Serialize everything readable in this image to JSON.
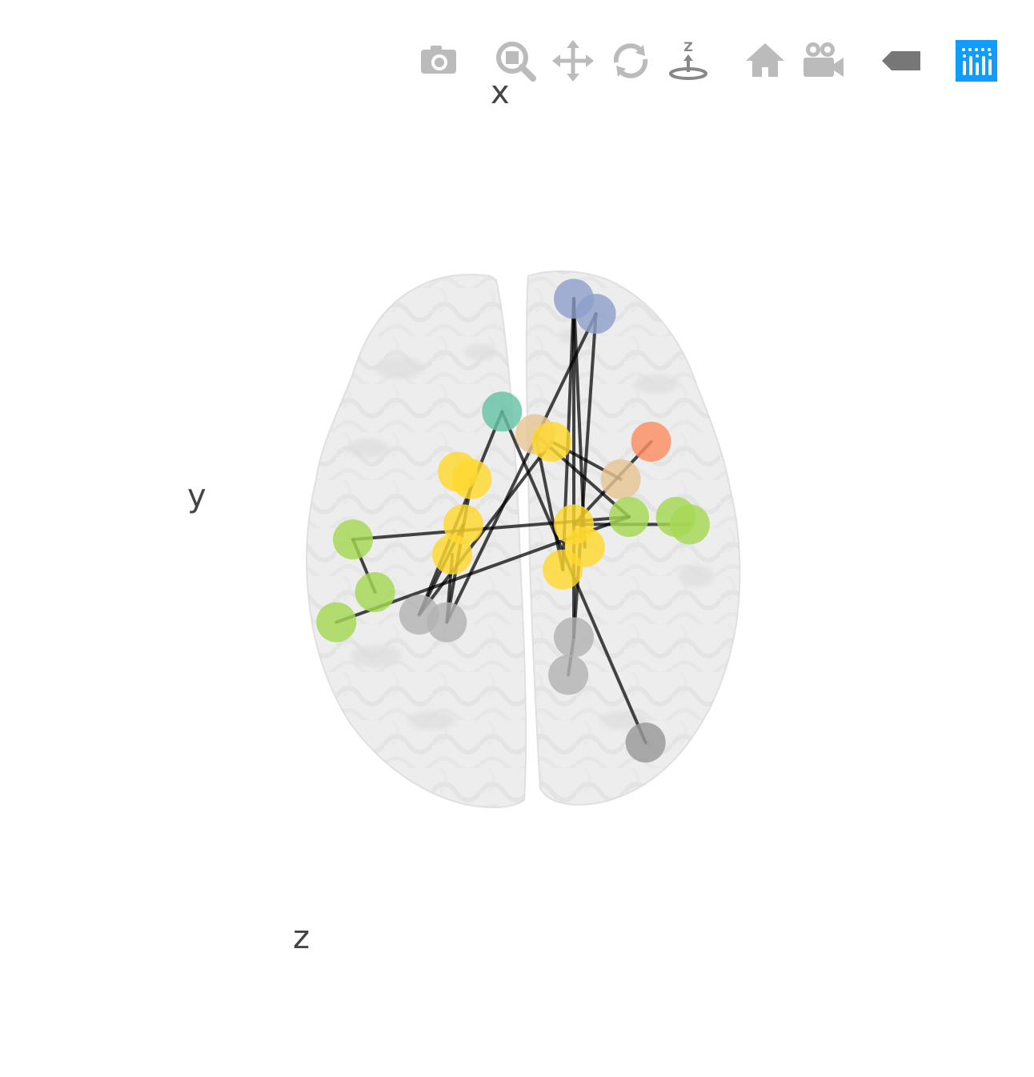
{
  "modebar": {
    "buttons": [
      {
        "name": "download-plot-button",
        "icon": "camera-icon",
        "active": false
      },
      {
        "name": "zoom-button",
        "icon": "zoom-icon",
        "active": false
      },
      {
        "name": "pan-button",
        "icon": "pan-icon",
        "active": false
      },
      {
        "name": "orbit-rotation-button",
        "icon": "orbit-rotation-icon",
        "active": false
      },
      {
        "name": "turntable-rotation-button",
        "icon": "turntable-rotation-icon",
        "active": true
      },
      {
        "name": "reset-camera-default-button",
        "icon": "home-icon",
        "active": false
      },
      {
        "name": "reset-camera-last-save-button",
        "icon": "movie-camera-icon",
        "active": false
      },
      {
        "name": "toggle-hover-button",
        "icon": "tag-icon",
        "active": false
      },
      {
        "name": "plotly-logo-link",
        "icon": "plotly-logo-icon",
        "active": false
      }
    ],
    "colors": {
      "icon": "#bbbbbb",
      "active_icon": "#888888",
      "logo_bg": "#119dff"
    }
  },
  "scene": {
    "axes": {
      "x": "x",
      "y": "y",
      "z": "z"
    },
    "colors": {
      "brain": "#e6e6e6",
      "edge": "#000000",
      "nodes": [
        "#8da0cb",
        "#66c2a5",
        "#fc8d62",
        "#e5c494",
        "#ffd92f",
        "#a6d854",
        "#b3b3b3"
      ]
    }
  },
  "chart_data": {
    "type": "scatter3d",
    "title": "",
    "note": "",
    "nodes": [
      {
        "id": 0,
        "x": 20,
        "y": 58,
        "color": "#8da0cb"
      },
      {
        "id": 1,
        "x": 28,
        "y": 54,
        "color": "#8da0cb"
      },
      {
        "id": 2,
        "x": -6,
        "y": 28,
        "color": "#66c2a5"
      },
      {
        "id": 3,
        "x": 48,
        "y": 20,
        "color": "#fc8d62"
      },
      {
        "id": 4,
        "x": 6,
        "y": 22,
        "color": "#e5c494"
      },
      {
        "id": 5,
        "x": 37,
        "y": 10,
        "color": "#e5c494"
      },
      {
        "id": 6,
        "x": 12,
        "y": 20,
        "color": "#ffd92f"
      },
      {
        "id": 7,
        "x": -22,
        "y": 12,
        "color": "#ffd92f"
      },
      {
        "id": 8,
        "x": -17,
        "y": 10,
        "color": "#ffd92f"
      },
      {
        "id": 9,
        "x": -20,
        "y": -2,
        "color": "#ffd92f"
      },
      {
        "id": 10,
        "x": -24,
        "y": -10,
        "color": "#ffd92f"
      },
      {
        "id": 11,
        "x": 20,
        "y": -2,
        "color": "#ffd92f"
      },
      {
        "id": 12,
        "x": 24,
        "y": -8,
        "color": "#ffd92f"
      },
      {
        "id": 13,
        "x": 16,
        "y": -14,
        "color": "#ffd92f"
      },
      {
        "id": 14,
        "x": -60,
        "y": -6,
        "color": "#a6d854"
      },
      {
        "id": 15,
        "x": -52,
        "y": -20,
        "color": "#a6d854"
      },
      {
        "id": 16,
        "x": -66,
        "y": -28,
        "color": "#a6d854"
      },
      {
        "id": 17,
        "x": 40,
        "y": 0,
        "color": "#a6d854"
      },
      {
        "id": 18,
        "x": 57,
        "y": 0,
        "color": "#a6d854"
      },
      {
        "id": 19,
        "x": 62,
        "y": -2,
        "color": "#a6d854"
      },
      {
        "id": 20,
        "x": -36,
        "y": -26,
        "color": "#b3b3b3"
      },
      {
        "id": 21,
        "x": -26,
        "y": -28,
        "color": "#b3b3b3"
      },
      {
        "id": 22,
        "x": 20,
        "y": -32,
        "color": "#b3b3b3"
      },
      {
        "id": 23,
        "x": 18,
        "y": -42,
        "color": "#b3b3b3"
      },
      {
        "id": 24,
        "x": 46,
        "y": -60,
        "color": "#999999"
      }
    ],
    "edges": [
      [
        0,
        22
      ],
      [
        1,
        22
      ],
      [
        1,
        21
      ],
      [
        0,
        13
      ],
      [
        2,
        24
      ],
      [
        2,
        20
      ],
      [
        3,
        11
      ],
      [
        4,
        17
      ],
      [
        5,
        6
      ],
      [
        8,
        21
      ],
      [
        9,
        20
      ],
      [
        14,
        17
      ],
      [
        14,
        15
      ],
      [
        16,
        17
      ],
      [
        13,
        4
      ],
      [
        12,
        0
      ],
      [
        6,
        20
      ],
      [
        23,
        22
      ],
      [
        10,
        21
      ],
      [
        11,
        19
      ],
      [
        7,
        7
      ]
    ]
  }
}
